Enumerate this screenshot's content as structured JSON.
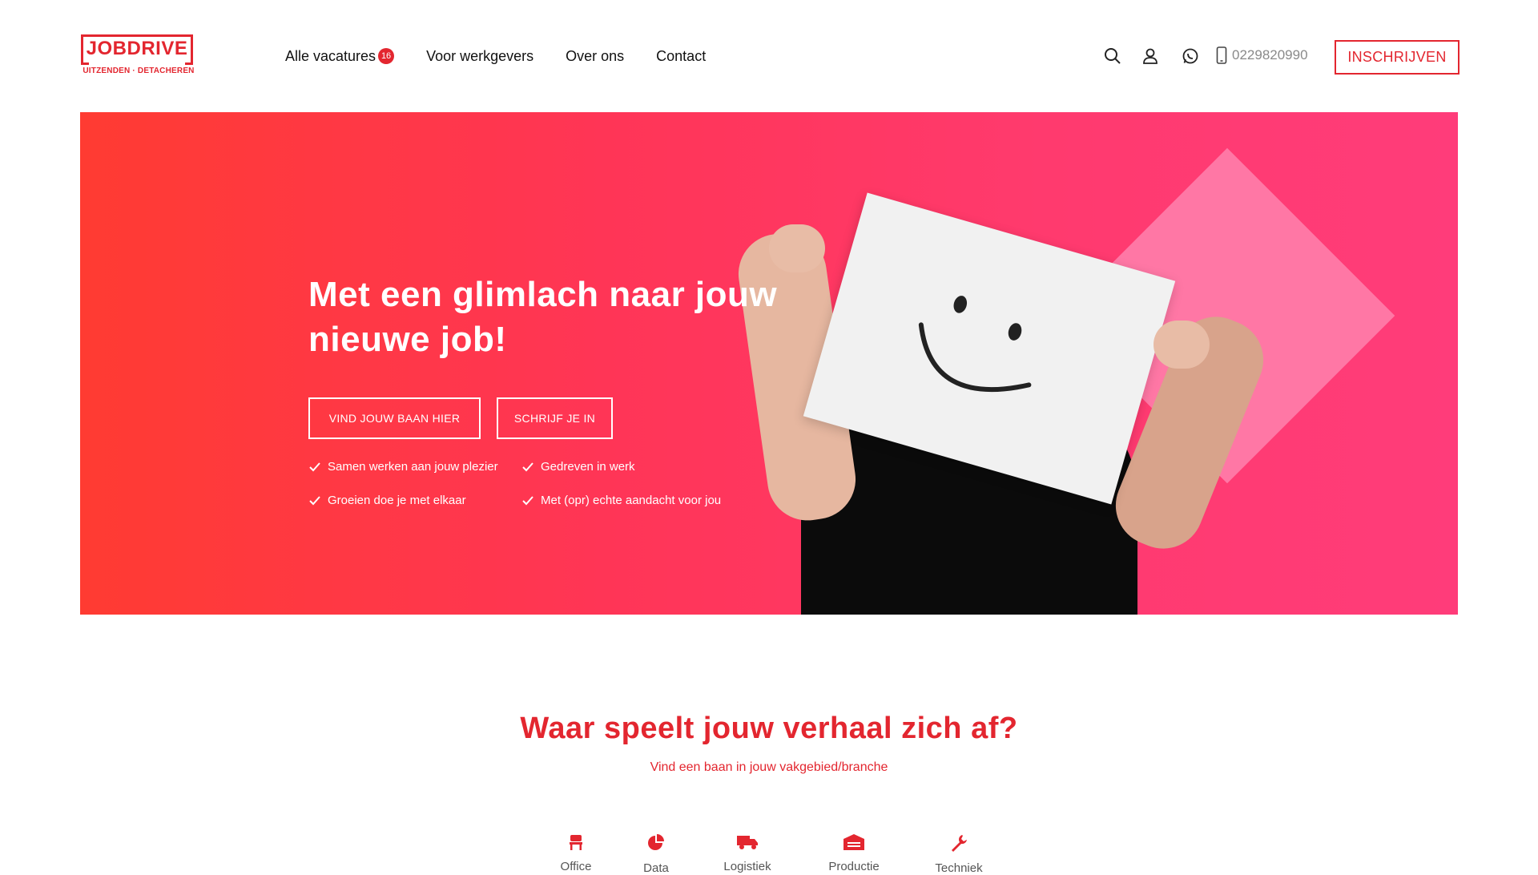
{
  "brand": {
    "name": "JOBDRIVE",
    "tagline": "UITZENDEN · DETACHEREN",
    "accent": "#e3262f"
  },
  "nav": {
    "items": [
      {
        "label": "Alle vacatures",
        "badge": "16"
      },
      {
        "label": "Voor werkgevers"
      },
      {
        "label": "Over ons"
      },
      {
        "label": "Contact"
      }
    ]
  },
  "header": {
    "icons": [
      "search-icon",
      "user-icon",
      "whatsapp-icon",
      "phone-icon"
    ],
    "phone": "0229820990",
    "cta": "INSCHRIJVEN"
  },
  "hero": {
    "title_line1": "Met een glimlach naar jouw",
    "title_line2": "nieuwe job!",
    "btn_primary": "VIND JOUW BAAN HIER",
    "btn_secondary": "SCHRIJF JE IN",
    "usps": [
      "Samen werken aan jouw plezier",
      "Gedreven in werk",
      "Groeien doe je met elkaar",
      "Met (opr) echte aandacht voor jou"
    ],
    "gradient": [
      "#ff3b32",
      "#ff3c7a"
    ],
    "diamond_color": "#ff7aa8"
  },
  "section": {
    "title": "Waar speelt jouw verhaal zich af?",
    "subtitle": "Vind een baan in jouw vakgebied/branche",
    "categories": [
      {
        "icon": "chair-icon",
        "label": "Office"
      },
      {
        "icon": "pie-chart-icon",
        "label": "Data"
      },
      {
        "icon": "truck-icon",
        "label": "Logistiek"
      },
      {
        "icon": "warehouse-icon",
        "label": "Productie"
      },
      {
        "icon": "wrench-icon",
        "label": "Techniek"
      }
    ]
  }
}
